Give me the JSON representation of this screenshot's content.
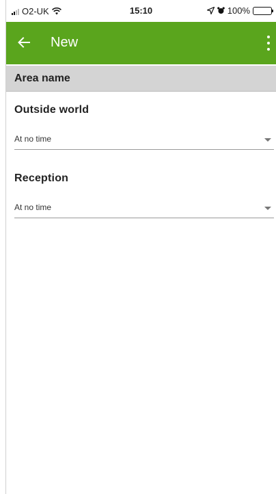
{
  "status_bar": {
    "carrier": "O2-UK",
    "time": "15:10",
    "battery": "100%",
    "signal_icon": "signal-bars-icon",
    "wifi_icon": "wifi-icon",
    "location_icon": "location-arrow-icon",
    "alarm_icon": "alarm-icon",
    "battery_icon": "battery-icon"
  },
  "app_bar": {
    "title": "New",
    "back_icon": "arrow-left-icon",
    "menu_icon": "more-vertical-icon",
    "color": "#5aa51d"
  },
  "section": {
    "label": "Area name",
    "background": "#d4d4d4"
  },
  "areas": [
    {
      "title": "Outside world",
      "selected": "At no time"
    },
    {
      "title": "Reception",
      "selected": "At no time"
    }
  ]
}
